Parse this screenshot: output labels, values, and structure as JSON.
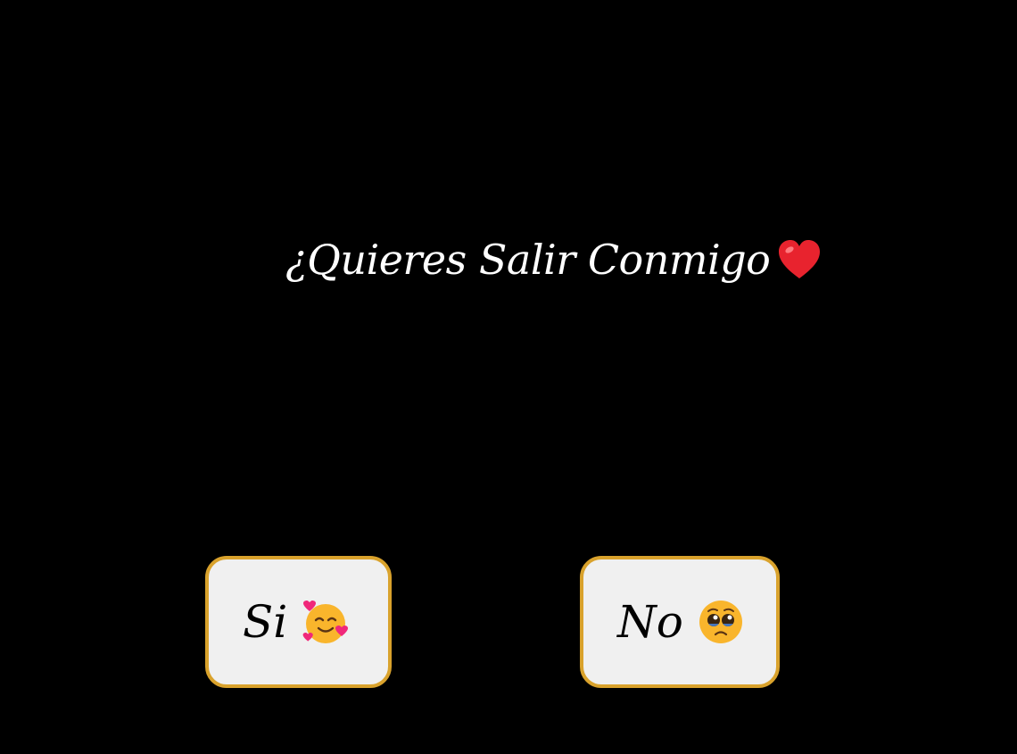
{
  "question": {
    "text": "¿Quieres Salir Conmigo",
    "icon": "heart-icon"
  },
  "buttons": {
    "yes": {
      "label": "Si",
      "icon": "smiling-face-with-hearts-icon"
    },
    "no": {
      "label": "No",
      "icon": "pleading-face-icon"
    }
  },
  "colors": {
    "background": "#000000",
    "question_text": "#ffffff",
    "button_fill": "#f0f0f0",
    "button_border": "#d9a22c",
    "heart": "#e8232e",
    "emoji_face": "#f9b52c",
    "emoji_hearts": "#f0287a"
  }
}
